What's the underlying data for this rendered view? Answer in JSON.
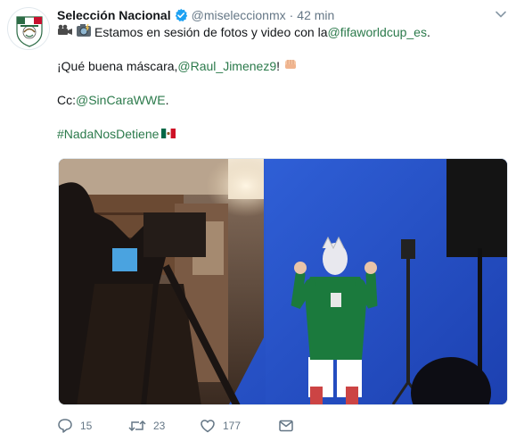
{
  "tweet": {
    "display_name": "Selección Nacional",
    "handle": "@miseleccionmx",
    "separator": "·",
    "time": "42 min",
    "line1_text": "Estamos en sesión de fotos y video con la ",
    "line1_mention": "@fifaworldcup_es",
    "line1_end": ".",
    "line2_text": "¡Qué buena máscara, ",
    "line2_mention": "@Raul_Jimenez9",
    "line2_end": "!",
    "line3_text": "Cc: ",
    "line3_mention": "@SinCaraWWE",
    "line3_end": ".",
    "hashtag": "#NadaNosDetiene"
  },
  "actions": {
    "replies": "15",
    "retweets": "23",
    "likes": "177"
  },
  "icons": {
    "avatar": "mexico-crest-icon",
    "verified": "verified-badge-icon",
    "caret": "chevron-down-icon",
    "video_camera": "video-camera-emoji",
    "camera_flash": "camera-flash-emoji",
    "fist": "oncoming-fist-emoji",
    "flag": "mexico-flag-emoji",
    "reply": "reply-icon",
    "retweet": "retweet-icon",
    "like": "heart-icon",
    "dm": "envelope-icon"
  },
  "colors": {
    "link": "#2b7a4b",
    "text": "#14171a",
    "muted": "#657786",
    "verified": "#1da1f2"
  }
}
